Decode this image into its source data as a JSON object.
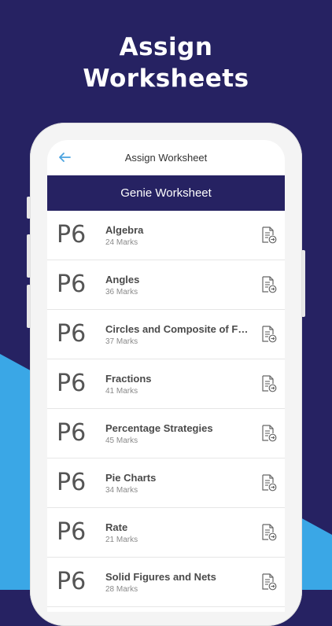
{
  "promo": {
    "line1": "Assign",
    "line2": "Worksheets"
  },
  "header": {
    "title": "Assign Worksheet"
  },
  "banner": {
    "title": "Genie Worksheet"
  },
  "worksheets": [
    {
      "grade": "P6",
      "title": "Algebra",
      "marks": "24 Marks"
    },
    {
      "grade": "P6",
      "title": "Angles",
      "marks": "36 Marks"
    },
    {
      "grade": "P6",
      "title": "Circles and Composite of Fig...",
      "marks": "37 Marks"
    },
    {
      "grade": "P6",
      "title": "Fractions",
      "marks": "41 Marks"
    },
    {
      "grade": "P6",
      "title": "Percentage Strategies",
      "marks": "45 Marks"
    },
    {
      "grade": "P6",
      "title": "Pie Charts",
      "marks": "34 Marks"
    },
    {
      "grade": "P6",
      "title": "Rate",
      "marks": "21 Marks"
    },
    {
      "grade": "P6",
      "title": "Solid Figures and Nets",
      "marks": "28 Marks"
    }
  ],
  "colors": {
    "navy": "#262262",
    "blue": "#3aa7e6",
    "accent": "#4aa3df"
  }
}
